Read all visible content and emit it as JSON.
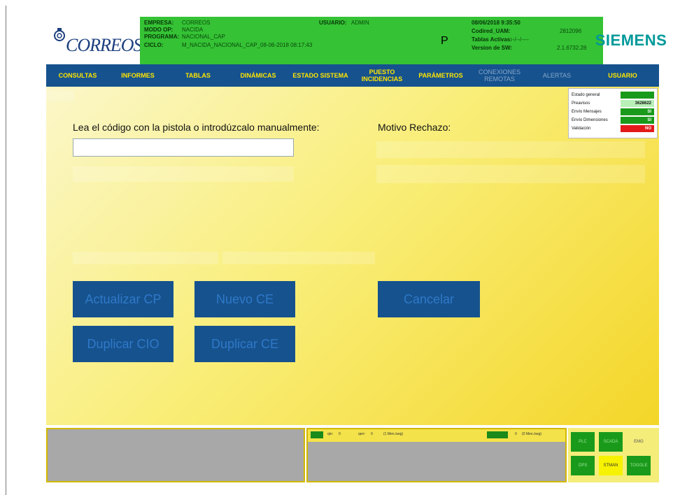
{
  "header": {
    "logo_text": "CORREOS",
    "empresa_label": "EMPRESA:",
    "empresa": "CORREOS",
    "modo_label": "MODO OP:",
    "modo": "NACIDA",
    "programa_label": "PROGRAMA:",
    "programa": "NACIONAL_CAP",
    "ciclo_label": "CICLO:",
    "ciclo": "M_NACIDA_NACIONAL_CAP_08-06-2018 08:17:43",
    "usuario_label": "USUARIO:",
    "usuario": "ADMIN",
    "mode_letter": "P",
    "datetime": "08/06/2018 9:35:50",
    "codired_label": "Codired_UAM:",
    "codired": "2812096",
    "tablas_label": "Tablas Activas:",
    "tablas": "--/--/----",
    "version_label": "Version de SW:",
    "version": "2.1.6732.28",
    "brand": "SIEMENS"
  },
  "menu": [
    {
      "label": "CONSULTAS",
      "enabled": true
    },
    {
      "label": "INFORMES",
      "enabled": true
    },
    {
      "label": "TABLAS",
      "enabled": true
    },
    {
      "label": "DINÁMICAS",
      "enabled": true
    },
    {
      "label": "ESTADO SISTEMA",
      "enabled": true
    },
    {
      "label": "PUESTO INCIDENCIAS",
      "enabled": true
    },
    {
      "label": "PARÁMETROS",
      "enabled": true
    },
    {
      "label": "CONEXIONES REMOTAS",
      "enabled": false
    },
    {
      "label": "ALERTAS",
      "enabled": false
    },
    {
      "label": "USUARIO",
      "enabled": true
    }
  ],
  "main": {
    "code_prompt": "Lea el código con la pistola o introdúzcalo manualmente:",
    "code_value": "",
    "reject_label": "Motivo Rechazo:",
    "buttons": {
      "actualizar_cp": "Actualizar CP",
      "nuevo_ce": "Nuevo CE",
      "cancelar": "Cancelar",
      "duplicar_cio": "Duplicar CIO",
      "duplicar_ce": "Duplicar CE"
    }
  },
  "status_panel": {
    "rows": [
      {
        "label": "Estado general",
        "value": "",
        "color": "#1a9a1a"
      },
      {
        "label": "Preavisos",
        "value": "3628622",
        "color": "#b8f0b8"
      },
      {
        "label": "Envío Mensajes",
        "value": "SI",
        "color": "#1a9a1a"
      },
      {
        "label": "Envío Dimensiones",
        "value": "SI",
        "color": "#1a9a1a"
      },
      {
        "label": "Validación",
        "value": "NO",
        "color": "#e21a1a"
      }
    ]
  },
  "bottom_bar": {
    "qin_label": "qin:",
    "qin": "0",
    "qerr_label": "qerr:",
    "qerr": "0",
    "msg_left": "(1 Men./seg)",
    "right_value": "0",
    "msg_right": "(0 Men./seg)"
  },
  "indicators": [
    {
      "label": "PLC",
      "color": "#1a9a1a"
    },
    {
      "label": "SCADA",
      "color": "#1a9a1a"
    },
    {
      "label": "EMG",
      "color": "#f5ed7a"
    },
    {
      "label": "OPS",
      "color": "#1a9a1a"
    },
    {
      "label": "STMAN",
      "color": "#f7f200"
    },
    {
      "label": "TOGGLE",
      "color": "#1a9a1a"
    }
  ]
}
